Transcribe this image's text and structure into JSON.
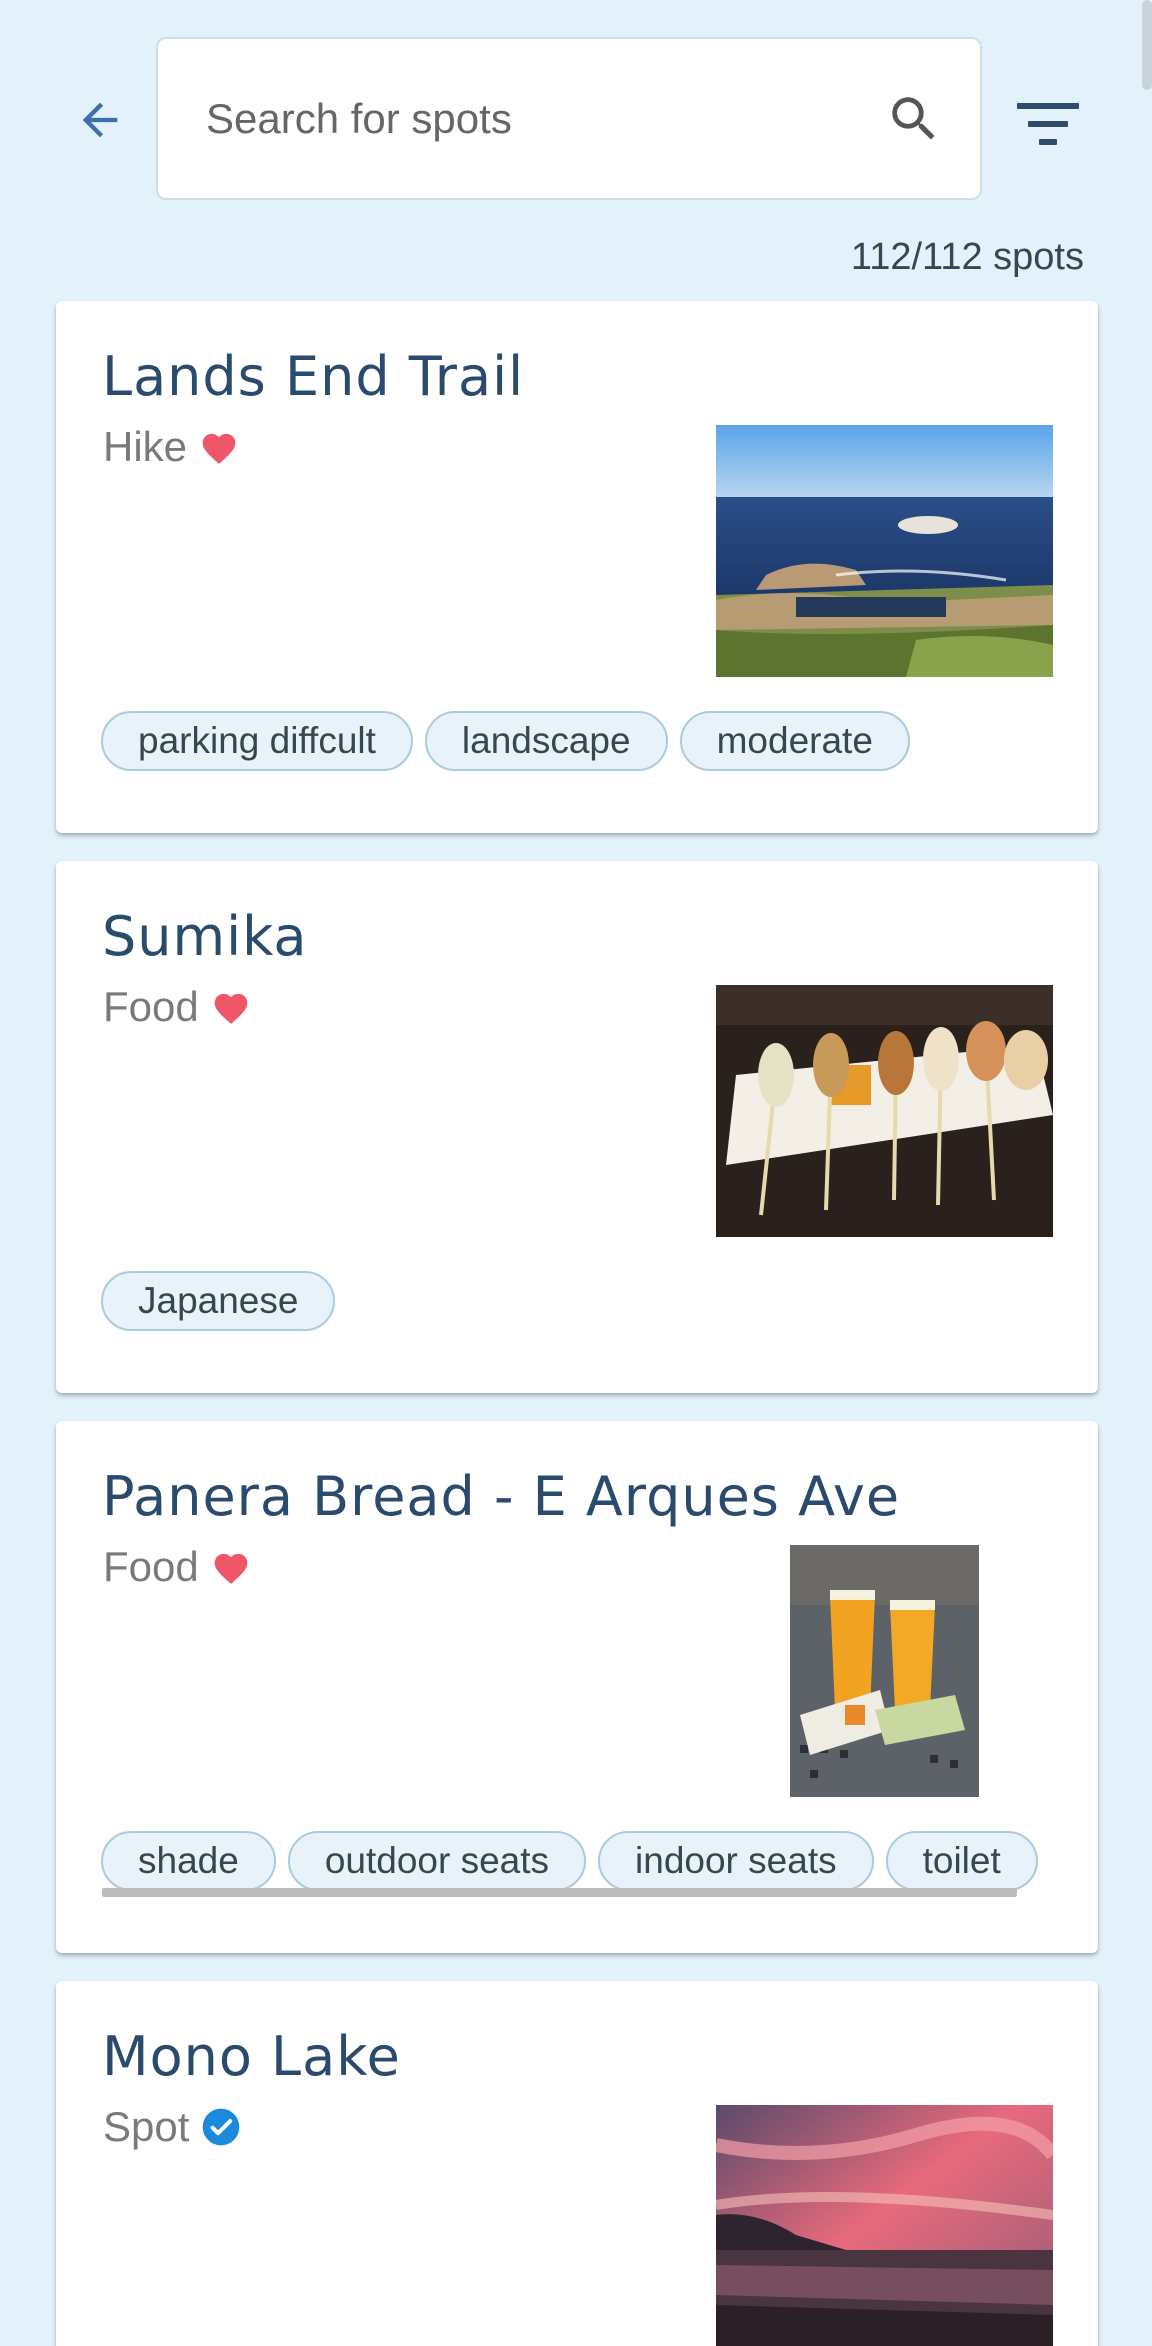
{
  "header": {
    "search_placeholder": "Search for spots",
    "back_icon": "arrow-left-icon",
    "search_icon": "search-icon",
    "filter_icon": "filter-icon",
    "result_count": "112/112 spots"
  },
  "colors": {
    "background": "#e3f1fb",
    "accent": "#3d6fa8",
    "title": "#2a4a6e",
    "heart": "#f0566a",
    "verified": "#1a8bdc",
    "tag_border": "#a9cbe0",
    "tag_bg": "#e8f2f9"
  },
  "cards": [
    {
      "title": "Lands End Trail",
      "category": "Hike",
      "badge_icon": "heart-icon",
      "image_subject": "coastal landscape photo",
      "tags": [
        "parking diffcult",
        "landscape",
        "moderate"
      ]
    },
    {
      "title": "Sumika",
      "category": "Food",
      "badge_icon": "heart-icon",
      "image_subject": "yakitori skewers photo",
      "tags": [
        "Japanese"
      ]
    },
    {
      "title": "Panera Bread - E Arques Ave",
      "category": "Food",
      "badge_icon": "heart-icon",
      "image_subject": "iced drinks and wrap photo",
      "tags": [
        "shade",
        "outdoor seats",
        "indoor seats",
        "toilet"
      ]
    },
    {
      "title": "Mono Lake",
      "category": "Spot",
      "badge_icon": "verified-icon",
      "image_subject": "pink sunset over lake photo",
      "tags": []
    }
  ]
}
